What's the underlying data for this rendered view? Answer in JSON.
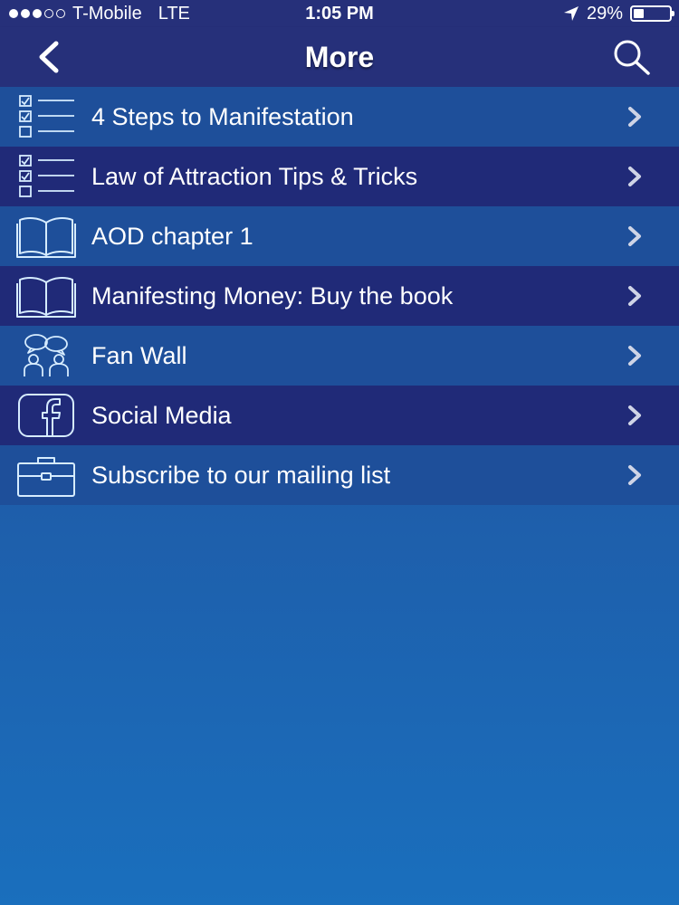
{
  "status_bar": {
    "carrier": "T-Mobile",
    "network": "LTE",
    "time": "1:05 PM",
    "battery": "29%",
    "battery_level": 0.29,
    "signal_bars_filled": 3,
    "signal_bars_total": 5
  },
  "nav": {
    "title": "More",
    "back_icon": "chevron-left-icon",
    "search_icon": "search-icon"
  },
  "menu": {
    "items": [
      {
        "label": "4 Steps to Manifestation",
        "icon": "checklist-icon"
      },
      {
        "label": "Law of Attraction Tips & Tricks",
        "icon": "checklist-icon"
      },
      {
        "label": "AOD chapter 1",
        "icon": "open-book-icon"
      },
      {
        "label": "Manifesting Money: Buy the book",
        "icon": "open-book-icon"
      },
      {
        "label": "Fan Wall",
        "icon": "people-chat-icon"
      },
      {
        "label": "Social Media",
        "icon": "facebook-icon"
      },
      {
        "label": "Subscribe to our mailing list",
        "icon": "briefcase-icon"
      }
    ]
  },
  "colors": {
    "navbar": "#26307a",
    "row_light": "#1e4f9a",
    "row_dark": "#202a78",
    "icon_stroke": "#d6ecff",
    "chevron": "#cfd4e6"
  }
}
